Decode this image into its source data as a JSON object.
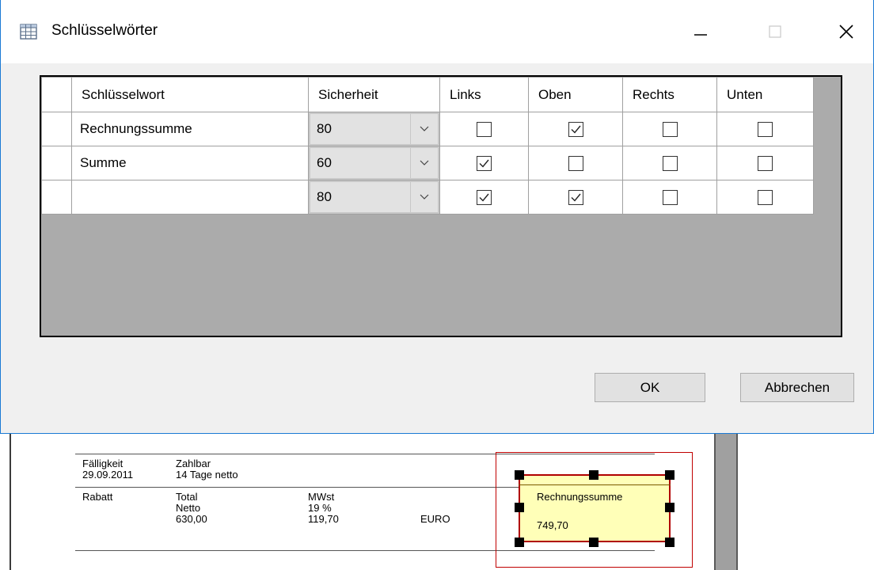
{
  "dialog": {
    "title": "Schlüsselwörter",
    "icon": "table-grid-icon",
    "controls": {
      "minimize": "minimize-icon",
      "maximize": "maximize-icon",
      "close": "close-icon"
    }
  },
  "grid": {
    "headers": [
      "Schlüsselwort",
      "Sicherheit",
      "Links",
      "Oben",
      "Rechts",
      "Unten"
    ],
    "rows": [
      {
        "keyword": "Rechnungssumme",
        "sicherheit": "80",
        "links": false,
        "oben": true,
        "rechts": false,
        "unten": false
      },
      {
        "keyword": "Summe",
        "sicherheit": "60",
        "links": true,
        "oben": false,
        "rechts": false,
        "unten": false
      },
      {
        "keyword": "",
        "sicherheit": "80",
        "links": true,
        "oben": true,
        "rechts": false,
        "unten": false
      }
    ]
  },
  "buttons": {
    "ok": "OK",
    "cancel": "Abbrechen"
  },
  "document": {
    "faelligkeit_label": "Fälligkeit",
    "faelligkeit_value": "29.09.2011",
    "zahlbar_label": "Zahlbar",
    "zahlbar_value": "14 Tage netto",
    "rabatt_label": "Rabatt",
    "total_label": "Total",
    "netto_label": "Netto",
    "netto_value": "630,00",
    "mwst_label": "MWst",
    "mwst_rate": "19 %",
    "mwst_value": "119,70",
    "currency": "EURO",
    "highlight_label": "Rechnungssumme",
    "highlight_value": "749,70"
  },
  "colors": {
    "accent": "#1a7ad4",
    "highlight_fill": "#ffffb8",
    "highlight_border": "#b00000",
    "grid_background": "#ababab"
  }
}
